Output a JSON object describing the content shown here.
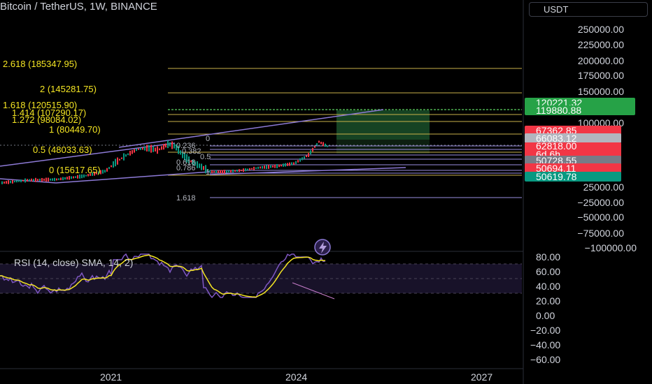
{
  "header": {
    "title": "Bitcoin / TetherUS, 1W, BINANCE",
    "currency": "USDT"
  },
  "price_axis": {
    "ticks": [
      "250000.00",
      "225000.00",
      "200000.00",
      "175000.00",
      "150000.00",
      "100000.00",
      "25000.00",
      "−25000.00",
      "−50000.00",
      "−75000.00",
      "−100000.00"
    ]
  },
  "price_tags": [
    {
      "label": "120221.32",
      "color": "#26a247"
    },
    {
      "label": "119880.88",
      "color": "#26a247"
    },
    {
      "label": "67362.85",
      "color": "#f23645"
    },
    {
      "label": "66083.12",
      "color": "#b2b5be"
    },
    {
      "label": "62818.00",
      "color": "#f23645"
    },
    {
      "label": "6d 6h",
      "color": "#f23645"
    },
    {
      "label": "50728.55",
      "color": "#787b86"
    },
    {
      "label": "50694.11",
      "color": "#f23645"
    },
    {
      "label": "50619.78",
      "color": "#089981"
    }
  ],
  "fib_labels": [
    {
      "text": "2.618 (185347.95)"
    },
    {
      "text": "2 (145281.75)"
    },
    {
      "text": "1.618 (120515.90)"
    },
    {
      "text": "1.414 (107290.17)"
    },
    {
      "text": "1.272 (98084.02)"
    },
    {
      "text": "1 (80449.70)"
    },
    {
      "text": "0.5 (48033.63)"
    },
    {
      "text": "0 (15617.65)"
    }
  ],
  "fib_small": [
    "0",
    "0.236",
    "0.382",
    "0.5",
    "0.618",
    "0.786",
    "1",
    "1.618"
  ],
  "rsi": {
    "label": "RSI (14, close) SMA, 14, 2)",
    "ticks": [
      "80.00",
      "60.00",
      "40.00",
      "20.00",
      "0.00",
      "−20.00",
      "−40.00",
      "−60.00"
    ]
  },
  "time_axis": {
    "ticks": [
      "2021",
      "2024",
      "2027"
    ]
  },
  "colors": {
    "fib_line": "#c9b04a",
    "fib_green": "#4caf50",
    "trend": "#8d7ad6",
    "rsi_line": "#7e57c2",
    "rsi_sma": "#f5e623",
    "up": "#089981",
    "down": "#f23645"
  },
  "icons": {
    "lightning": "lightning-icon"
  }
}
